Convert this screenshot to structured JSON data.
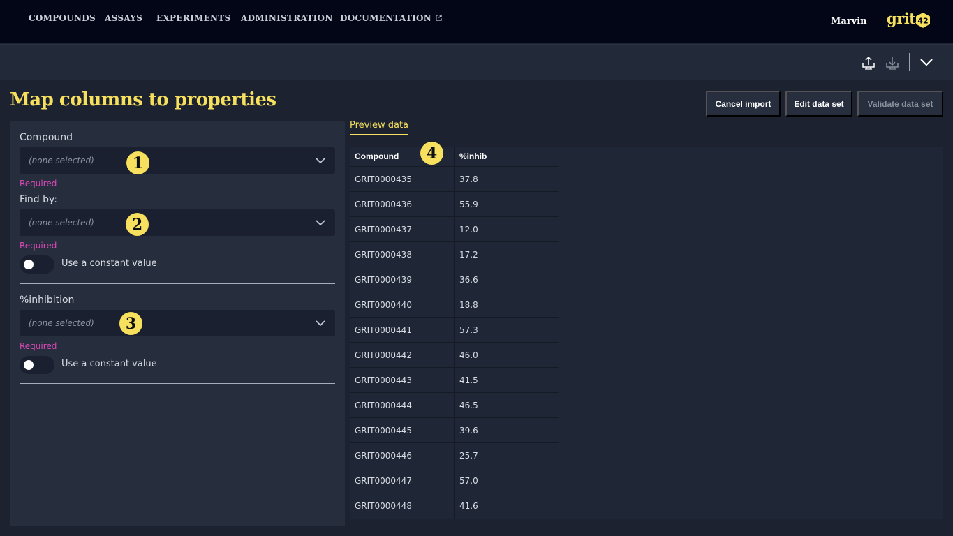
{
  "nav": {
    "items": [
      "COMPOUNDS",
      "ASSAYS",
      "EXPERIMENTS",
      "ADMINISTRATION",
      "DOCUMENTATION"
    ],
    "user": "Marvin",
    "logo_text": "grit",
    "logo_badge": "42"
  },
  "toolbar": {
    "icons": [
      "upload-icon",
      "download-icon",
      "chevron-down-icon"
    ]
  },
  "page": {
    "title": "Map columns to properties",
    "buttons": {
      "cancel": "Cancel import",
      "edit": "Edit data set",
      "validate": "Validate data set"
    }
  },
  "form": {
    "compound": {
      "label": "Compound",
      "placeholder": "(none selected)",
      "required": "Required"
    },
    "find_by": {
      "label": "Find by:",
      "placeholder": "(none selected)",
      "required": "Required",
      "toggle_label": "Use a constant value"
    },
    "inhibition": {
      "label": "%inhibition",
      "placeholder": "(none selected)",
      "required": "Required",
      "toggle_label": "Use a constant value"
    }
  },
  "badges": [
    "1",
    "2",
    "3",
    "4"
  ],
  "preview": {
    "tab": "Preview data",
    "columns": [
      "Compound",
      "%inhib"
    ],
    "rows": [
      [
        "GRIT0000435",
        "37.8"
      ],
      [
        "GRIT0000436",
        "55.9"
      ],
      [
        "GRIT0000437",
        "12.0"
      ],
      [
        "GRIT0000438",
        "17.2"
      ],
      [
        "GRIT0000439",
        "36.6"
      ],
      [
        "GRIT0000440",
        "18.8"
      ],
      [
        "GRIT0000441",
        "57.3"
      ],
      [
        "GRIT0000442",
        "46.0"
      ],
      [
        "GRIT0000443",
        "41.5"
      ],
      [
        "GRIT0000444",
        "46.5"
      ],
      [
        "GRIT0000445",
        "39.6"
      ],
      [
        "GRIT0000446",
        "25.7"
      ],
      [
        "GRIT0000447",
        "57.0"
      ],
      [
        "GRIT0000448",
        "41.6"
      ]
    ]
  },
  "colors": {
    "accent": "#f6e05e",
    "required": "#d94ab8",
    "nav_bg": "#020617",
    "panel_bg": "#262d3c"
  }
}
